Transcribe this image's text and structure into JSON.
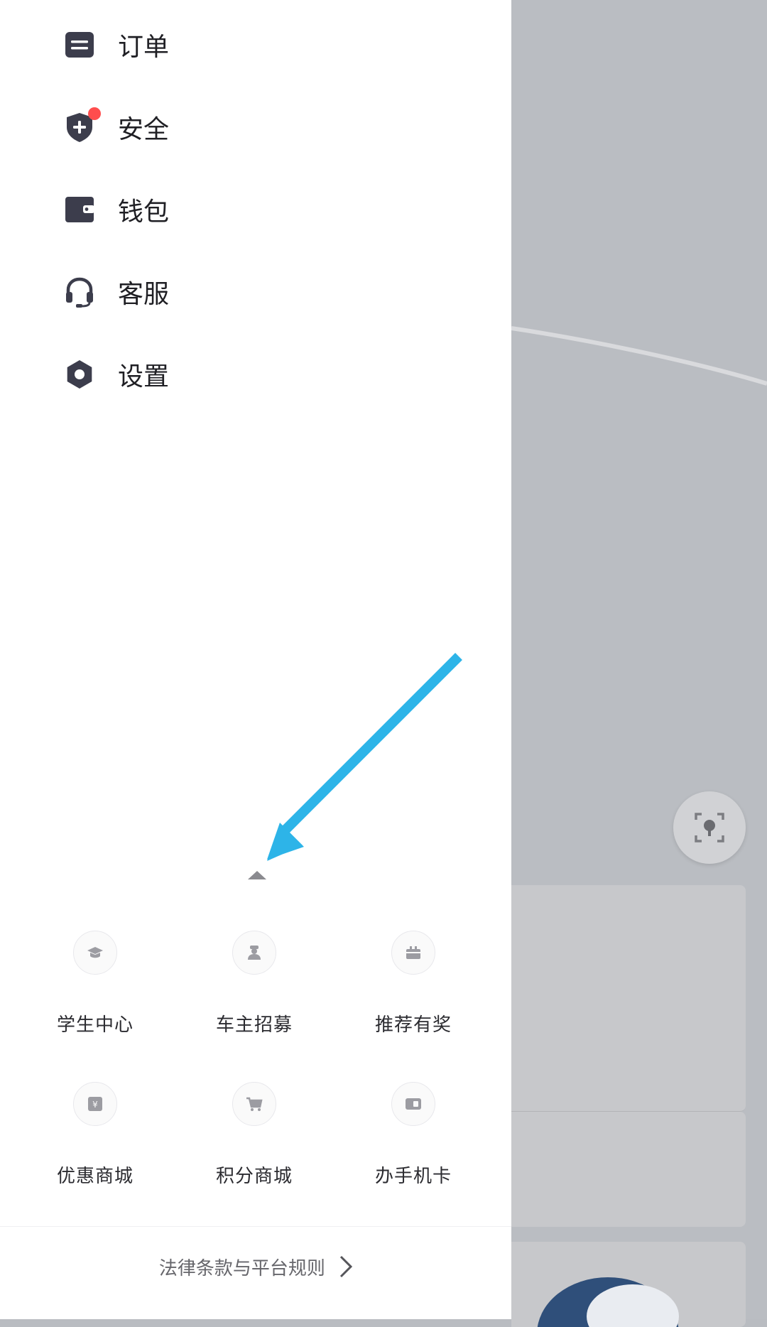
{
  "menu": [
    {
      "label": "订单",
      "icon": "order-icon"
    },
    {
      "label": "安全",
      "icon": "shield-icon",
      "badge": true
    },
    {
      "label": "钱包",
      "icon": "wallet-icon"
    },
    {
      "label": "客服",
      "icon": "headset-icon"
    },
    {
      "label": "设置",
      "icon": "gear-icon"
    }
  ],
  "services": [
    {
      "label": "学生中心",
      "icon": "graduation-cap-icon"
    },
    {
      "label": "车主招募",
      "icon": "driver-icon"
    },
    {
      "label": "推荐有奖",
      "icon": "gift-icon"
    },
    {
      "label": "优惠商城",
      "icon": "yen-bag-icon"
    },
    {
      "label": "积分商城",
      "icon": "cart-icon"
    },
    {
      "label": "办手机卡",
      "icon": "sim-card-icon"
    }
  ],
  "footer": {
    "legal": "法律条款与平台规则"
  },
  "colors": {
    "badge": "#ff4d4d",
    "annotation_arrow": "#2db4e8",
    "icon_dark": "#3c3d4c"
  }
}
